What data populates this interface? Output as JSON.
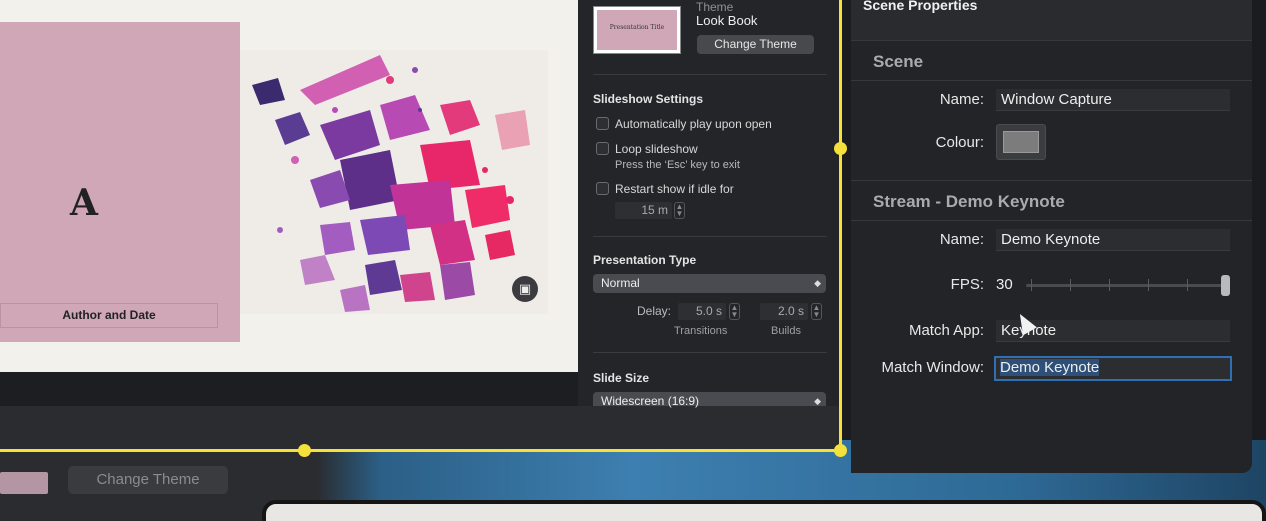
{
  "slide": {
    "letter": "A",
    "author_placeholder": "Author and Date",
    "theme_thumb_title": "Presentation Title"
  },
  "inspector": {
    "theme_label": "Theme",
    "theme_name": "Look Book",
    "change_theme": "Change Theme",
    "slideshow_settings": "Slideshow Settings",
    "auto_play": "Automatically play upon open",
    "loop": "Loop slideshow",
    "loop_hint": "Press the ‘Esc’ key to exit",
    "restart_idle": "Restart show if idle for",
    "idle_value": "15 m",
    "presentation_type": "Presentation Type",
    "presentation_type_value": "Normal",
    "delay_label": "Delay:",
    "transitions_value": "5.0 s",
    "builds_value": "2.0 s",
    "transitions_label": "Transitions",
    "builds_label": "Builds",
    "slide_size": "Slide Size",
    "slide_size_value": "Widescreen (16:9)"
  },
  "background": {
    "change_theme_ghost": "Change Theme"
  },
  "scene_properties": {
    "title": "Scene Properties",
    "scene_section": "Scene",
    "name_label": "Name:",
    "scene_name": "Window Capture",
    "colour_label": "Colour:",
    "colour_value": "#7c7c7c",
    "stream_section": "Stream - Demo Keynote",
    "stream_name_label": "Name:",
    "stream_name": "Demo Keynote",
    "fps_label": "FPS:",
    "fps_value": "30",
    "fps_slider_level": 1.0,
    "match_app_label": "Match App:",
    "match_app": "Keynote",
    "match_window_label": "Match Window:",
    "match_window": "Demo Keynote"
  },
  "colors": {
    "selection_frame": "#f5e13b",
    "slide_pink": "#cfa7b6",
    "focus_ring": "#2f6fb3"
  }
}
